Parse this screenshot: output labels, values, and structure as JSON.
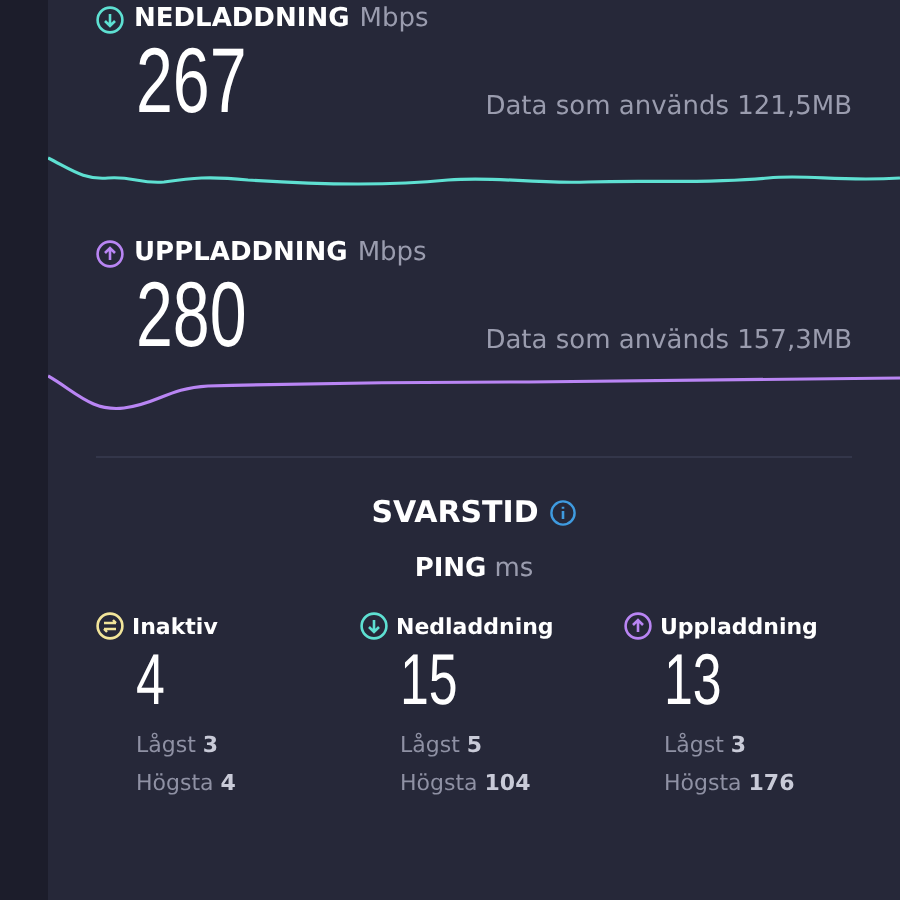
{
  "speeds": [
    {
      "kind": "download",
      "label": "NEDLADDNING",
      "unit": "Mbps",
      "value": "267",
      "data_used": "Data som används 121,5MB"
    },
    {
      "kind": "upload",
      "label": "UPPLADDNING",
      "unit": "Mbps",
      "value": "280",
      "data_used": "Data som används 157,3MB"
    }
  ],
  "latency": {
    "title": "SVARSTID",
    "ping_label": "PING",
    "ping_unit": "ms",
    "columns": [
      {
        "kind": "idle",
        "label": "Inaktiv",
        "value": "4",
        "low_label": "Lågst",
        "low": "3",
        "high_label": "Högsta",
        "high": "4"
      },
      {
        "kind": "download",
        "label": "Nedladdning",
        "value": "15",
        "low_label": "Lågst",
        "low": "5",
        "high_label": "Högsta",
        "high": "104"
      },
      {
        "kind": "upload",
        "label": "Uppladdning",
        "value": "13",
        "low_label": "Lågst",
        "low": "3",
        "high_label": "Högsta",
        "high": "176"
      }
    ]
  }
}
